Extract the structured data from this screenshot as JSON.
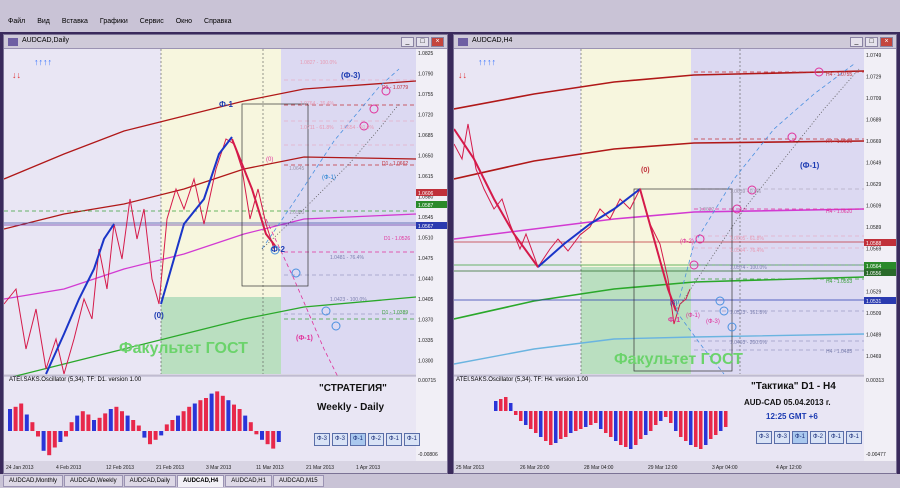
{
  "menu": [
    "Файл",
    "Вид",
    "Вставка",
    "Графики",
    "Сервис",
    "Окно",
    "Справка"
  ],
  "left": {
    "title": "AUDCAD,Daily",
    "indicator": "ATEI.SAKS.Oscillator (5,34). TF: D1. version 1.00",
    "strategy_title": "\"СТРАТЕГИЯ\"",
    "strategy_sub": "Weekly - Daily",
    "watermark": "Факультет ГОСТ",
    "arrows_up": "↑↑↑↑",
    "arrows_down": "↓↓",
    "price_ticks": [
      "1.0825",
      "1.0790",
      "1.0755",
      "1.0720",
      "1.0685",
      "1.0650",
      "1.0615",
      "1.0580",
      "1.0545",
      "1.0510",
      "1.0475",
      "1.0440",
      "1.0405",
      "1.0370",
      "1.0335",
      "1.0300"
    ],
    "osc_ticks": [
      "0.00715",
      "-0.00806"
    ],
    "time_ticks": [
      "24 Jan 2013",
      "4 Feb 2013",
      "12 Feb 2013",
      "21 Feb 2013",
      "3 Mar 2013",
      "11 Mar 2013",
      "21 Mar 2013",
      "1 Apr 2013"
    ],
    "price_tags": [
      "1.0606",
      "1.0587",
      "1.0567"
    ],
    "labels": {
      "phi1_top": "Ф-1",
      "phi3": "(Ф-3)",
      "zero_top": "(0)",
      "phi1_mid": "(Ф-1)",
      "phi2": "Ф-2",
      "zero_low": "(0)",
      "phi1_low": "(Ф-1)",
      "fib_100_top": "1.0827 - 100.0%",
      "d1_1": "D1 - 1.0779",
      "fib_764a": "1.0764 - 76.4%",
      "fib_618": "1.0711 - 61.8%",
      "fib_500": "1.0654 - 50.0%",
      "d1_2": "D1 - 1.0662",
      "fib_1": "1.0645",
      "fib_2": "1.0583",
      "d1_3": "D1 - 1.0526",
      "fib_764b": "1.0481 - 76.4%",
      "fib_100_low": "1.0423 - 100.0%",
      "d1_4": "D1 - 1.0389"
    },
    "phi_buttons": [
      "Ф-3",
      "Ф-3",
      "Ф-1",
      "Ф-2",
      "Ф-1",
      "Ф-1"
    ]
  },
  "right": {
    "title": "AUDCAD,H4",
    "indicator": "ATEI.SAKS.Oscillator (5,34). TF: H4. version 1.00",
    "tactic_title": "\"Тактика\"  D1 - H4",
    "pair_line": "AUD-CAD   05.04.2013  г.",
    "time_line": "12:25  GMT +6",
    "watermark": "Факультет ГОСТ",
    "arrows_up": "↑↑↑↑",
    "arrows_down": "↓↓",
    "price_ticks": [
      "1.0749",
      "1.0729",
      "1.0709",
      "1.0689",
      "1.0669",
      "1.0649",
      "1.0629",
      "1.0609",
      "1.0589",
      "1.0569",
      "1.0549",
      "1.0529",
      "1.0509",
      "1.0489",
      "1.0469"
    ],
    "osc_ticks": [
      "0.00313",
      "-0.00477"
    ],
    "time_ticks": [
      "25 Mar 2013",
      "26 Mar 20:00",
      "28 Mar 04:00",
      "29 Mar 12:00",
      "3 Apr 04:00",
      "4 Apr 12:00"
    ],
    "price_tags": [
      "1.0588",
      "1.0564",
      "1.0556",
      "1.0531"
    ],
    "labels": {
      "h4_1": "H4 - 1.0755",
      "h4_2": "H4 - 1.0688",
      "phi1": "(Ф-1)",
      "zero": "(0)",
      "fib_a": "1.0639 - 0.0%",
      "h4_3": "H4 - 1.0620",
      "fib_b": "1.0622",
      "fib_c": "1.0605 - 61.8%",
      "fib_d": "1.0594 - 76.4%",
      "phi2": "(Ф-2)",
      "fib_e": "1.0574 - 100.0%",
      "h4_4": "H4 - 1.0553",
      "fib_f": "1.0523 - 161.8%",
      "fib_g": "1.0493 - 200.0%",
      "h4_5": "H4 - 1.0485",
      "phi1_b": "(Ф-1)",
      "zero_b": "(0)",
      "phi1_c": "Ф-1",
      "phi3": "(Ф-3)"
    },
    "phi_buttons": [
      "Ф-3",
      "Ф-3",
      "Ф-1",
      "Ф-2",
      "Ф-1",
      "Ф-1"
    ]
  },
  "tabs": [
    "AUDCAD,Monthly",
    "AUDCAD,Weekly",
    "AUDCAD,Daily",
    "AUDCAD,H4",
    "AUDCAD,H1",
    "AUDCAD,M15"
  ],
  "active_tab": "AUDCAD,H4"
}
